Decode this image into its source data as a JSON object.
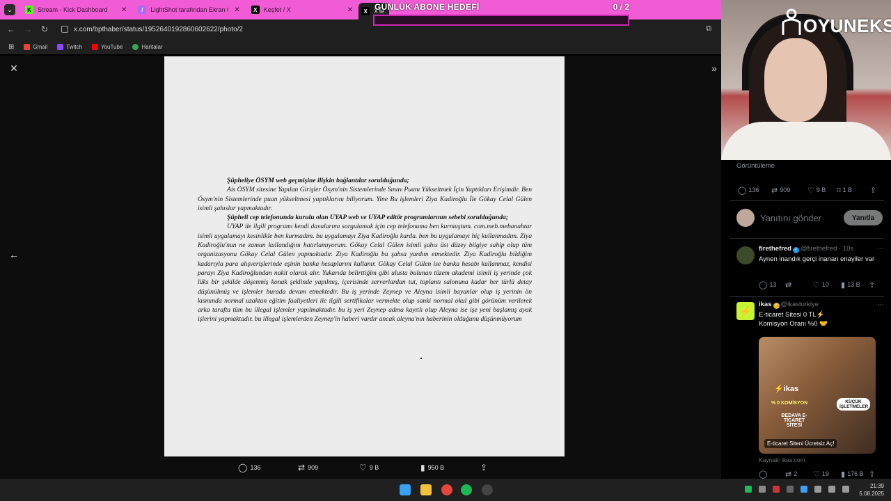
{
  "browser": {
    "tabs": [
      {
        "title": "Stream - Kick Dashboard",
        "icon": "kick-icon",
        "color": "#53fc18"
      },
      {
        "title": "LightShot tarafından Ekran Gö",
        "icon": "lightshot-icon",
        "color": "#a96cf0"
      },
      {
        "title": "Keşfet / X",
        "icon": "x-icon",
        "color": "#000000"
      },
      {
        "title": "X'te…",
        "icon": "x-icon",
        "color": "#000000"
      }
    ],
    "url": "x.com/bpthaber/status/1952640192860602622/photo/2",
    "bookmarks": [
      {
        "label": "Gmail",
        "color": "#ea4335"
      },
      {
        "label": "Twitch",
        "color": "#9146ff"
      },
      {
        "label": "YouTube",
        "color": "#ff0000"
      },
      {
        "label": "Haritalar",
        "color": "#34a853"
      }
    ],
    "accent": "#f25bd6"
  },
  "overlay": {
    "goal_title": "GÜNLÜK ABONE HEDEFİ",
    "goal_count": "0 / 2",
    "goal_progress": 0,
    "brand": "OYUNEKS"
  },
  "document": {
    "paragraphs": [
      {
        "bold": true,
        "indent": true,
        "text": "Şüpheliye ÖSYM web geçmişine ilişkin bağlantılar sorulduğunda;"
      },
      {
        "bold": false,
        "indent": true,
        "text": "Ais ÖSYM sitesine Yapılan Girişler Ösym'nin Sistemlerinde Sınav Puanı Yükseltmek İçin Yaptıkları Erişimdir. Ben Ösym'nin Sistemlerinde puan yükseltmesi yaptıklarını biliyorum. Yine Bu işlemleri Ziya Kadiroğlu İle Gökay Celal Gülen isimli şahıslar yapmaktadır."
      },
      {
        "bold": true,
        "indent": true,
        "text": "Şüpheli cep telefonunda kurulu olan UYAP web ve UYAP editör programlarının sebebi sorulduğunda;"
      },
      {
        "bold": false,
        "indent": true,
        "text": "UYAP ile ilgili programı kendi davalarımı sorgulamak için cep telefonuma ben kurmuştum. com.meb.mebanahtar isimli uygulamayı kesinlikle ben kurmadım. bu uygulamayı Ziya Kadiroğlu kurdu. ben bu uygulamayı hiç kullanmadım. Ziya Kadiroğlu'nun ne zaman kullandığını hatırlamıyorum. Gökay Celal Gülen isimli şahıs üst düzey bilgiye sahip olup tüm organizasyonu Gökay Celal Gülen yapmaktadır. Ziya Kadiroğlu bu şahsa yardım etmektedir. Ziya Kadiroğlu bildiğim kadarıyla para alışverişlerinde eşinin banka hesaplarını kullanır. Gökay Celal Gülen ise banka hesabı kullanmaz, kendisi parayı Ziya Kadiroğlundan nakit olarak alır. Yukarıda belirttiğim gibi ulusta bulunan tüzem akademi isimli iş yerinde çok lüks bir şekilde döşenmiş konak şeklinde yapılmış, içerisinde serverlardan tut, toplantı salonuna kadar her türlü detay düşünülmüş ve işlemler burada devam etmektedir. Bu iş yerinde Zeynep ve Aleyna isimli bayanlar olup iş yerinin ön kısmında normal uzaktan eğitim faaliyetleri ile ilgili sertifikalar vermekte olup sanki normal okul gibi görünüm verilerek arka tarafta tüm bu illegal işlemler yapılmaktadır. bu iş yeri Zeynep adına kayıtlı olup Aleyna ise işe yeni başlamış ayak işlerini yapmaktadır. bu illegal işlemlerden Zeynep'in haberi vardır ancak aleyna'nın haberinin olduğunu düşünmüyorum"
      }
    ]
  },
  "photo_actions": {
    "replies": "136",
    "reposts": "909",
    "likes": "9 B",
    "views": "950 B"
  },
  "side": {
    "views_label": "Görüntüleme",
    "stats": {
      "replies": "136",
      "reposts": "909",
      "likes": "9 B",
      "bookmarks": "1 B"
    },
    "reply_placeholder": "Yanıtını gönder",
    "reply_button": "Yanıtla",
    "tweets": [
      {
        "name": "firethefred",
        "handle": "@firethefred · 10s",
        "text": "Aynen inandık gerçi inanan enayiler var",
        "replies": "13",
        "likes": "10",
        "views": "13 B"
      },
      {
        "name": "ikas",
        "handle": "@ikasturkiye",
        "text": "E-ticaret Sitesi 0 TL⚡ Komisyon Oranı %0 🤝",
        "ad_logo": "⚡ikas",
        "ad_line1": "% 0 KOMİSYON",
        "ad_line2": "BEDAVA E-TİCARET SİTESİ",
        "ad_badge": "KÜÇÜK İŞLETMELER",
        "ad_cta": "E-ticaret Siteni Ücretsiz Aç!",
        "source": "Kaynak: ikas.com",
        "reposts": "2",
        "likes": "19",
        "views": "176 B"
      }
    ]
  },
  "taskbar": {
    "time": "21:39",
    "date": "5.08.2025"
  }
}
